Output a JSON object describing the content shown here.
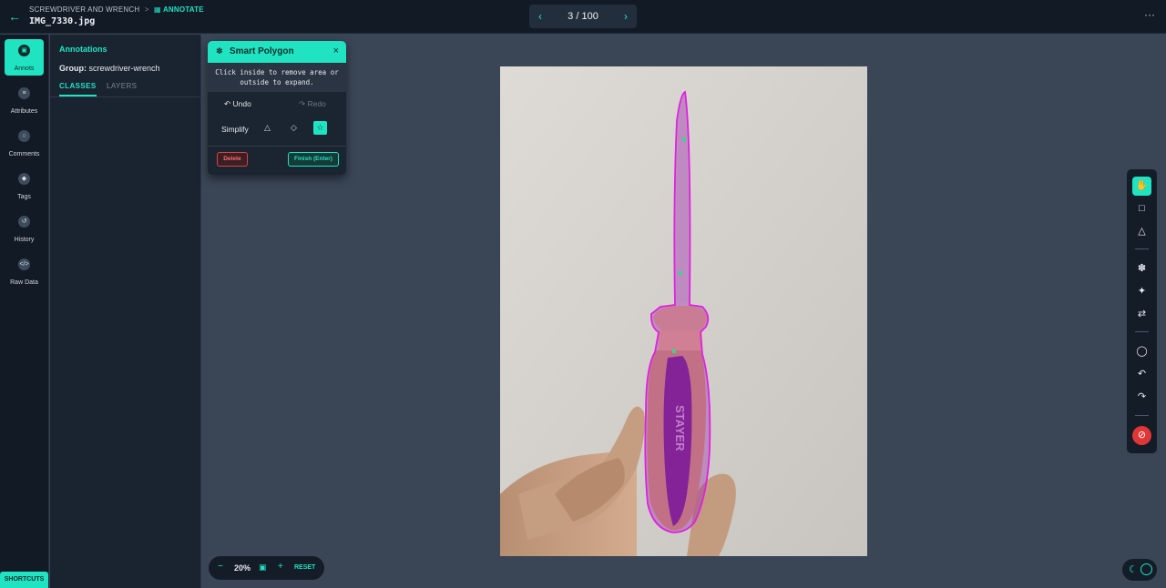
{
  "header": {
    "project": "SCREWDRIVER AND WRENCH",
    "separator": ">",
    "mode": "ANNOTATE",
    "filename": "IMG_7330.jpg",
    "pager": "3 / 100",
    "prev_icon": "chevron-left-icon",
    "next_icon": "chevron-right-icon",
    "more_label": "···"
  },
  "rail": {
    "items": [
      {
        "label": "Annots",
        "icon": "annotation-icon",
        "active": true
      },
      {
        "label": "Attributes",
        "icon": "list-icon",
        "active": false
      },
      {
        "label": "Comments",
        "icon": "comment-icon",
        "active": false
      },
      {
        "label": "Tags",
        "icon": "tag-icon",
        "active": false
      },
      {
        "label": "History",
        "icon": "history-icon",
        "active": false
      },
      {
        "label": "Raw Data",
        "icon": "code-icon",
        "active": false
      }
    ],
    "shortcuts_label": "SHORTCUTS"
  },
  "panel": {
    "title": "Annotations",
    "group_label": "Group:",
    "group_value": "screwdriver-wrench",
    "tabs": [
      "CLASSES",
      "LAYERS"
    ]
  },
  "smart_polygon": {
    "title": "Smart Polygon",
    "hint_line1": "Click inside to remove area or",
    "hint_line2": "outside to expand.",
    "undo_label": "Undo",
    "redo_label": "Redo",
    "simplify_label": "Simplify",
    "delete_label": "Delete",
    "finish_label": "Finish (Enter)"
  },
  "zoom": {
    "minus": "−",
    "value": "20%",
    "plus": "+",
    "reset_label": "RESET"
  },
  "image": {
    "brand_text": "STAYER"
  },
  "colors": {
    "accent": "#20e3c2",
    "polygon_stroke": "#e020e0",
    "danger": "#e03636"
  }
}
